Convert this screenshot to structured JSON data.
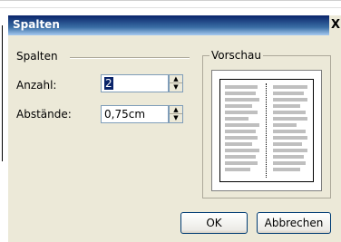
{
  "dialog": {
    "title": "Spalten",
    "close_label": "X"
  },
  "columns_group": {
    "label": "Spalten",
    "count_label": "Anzahl:",
    "count_value": "2",
    "spacing_label": "Abstände:",
    "spacing_value": "0,75cm"
  },
  "preview": {
    "label": "Vorschau"
  },
  "buttons": {
    "ok_label": "OK",
    "cancel_label": "Abbrechen"
  },
  "colors": {
    "title_bar": "#0a246a",
    "dialog_bg": "#ece9d8",
    "selection": "#0a246a"
  }
}
